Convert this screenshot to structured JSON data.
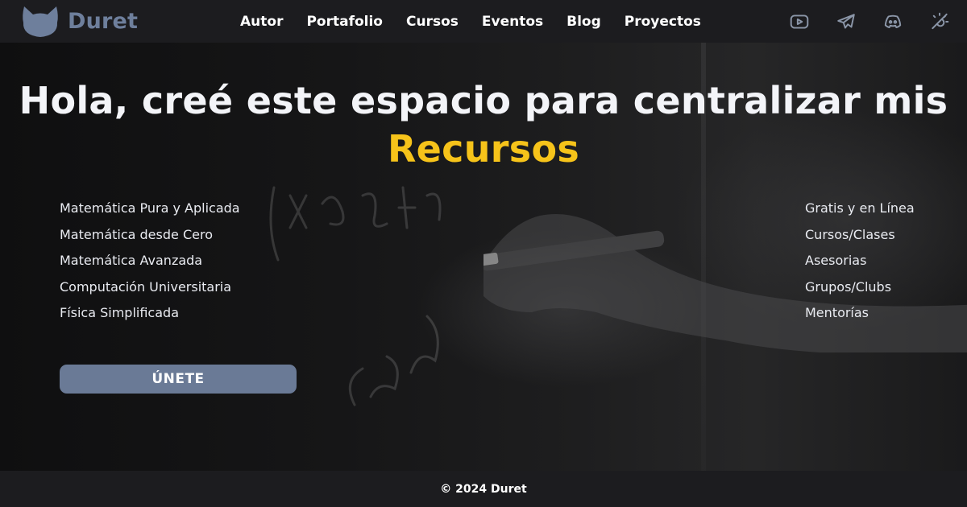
{
  "brand": {
    "name": "Duret",
    "logo_icon": "cat-head-icon",
    "color": "#6e7f9c"
  },
  "nav": {
    "links": [
      "Autor",
      "Portafolio",
      "Cursos",
      "Eventos",
      "Blog",
      "Proyectos"
    ],
    "icons": [
      "youtube-icon",
      "telegram-icon",
      "discord-icon",
      "theme-toggle-icon"
    ]
  },
  "hero": {
    "headline": "Hola, creé este espacio para centralizar mis",
    "accent": "Recursos",
    "accent_color": "#f6c31a",
    "topics": [
      "Matemática Pura y Aplicada",
      "Matemática desde Cero",
      "Matemática Avanzada",
      "Computación Universitaria",
      "Física Simplificada"
    ],
    "offerings": [
      "Gratis y en Línea",
      "Cursos/Clases",
      "Asesorias",
      "Grupos/Clubs",
      "Mentorías"
    ],
    "cta_label": "ÚNETE",
    "cta_color": "#6a7a96"
  },
  "footer": {
    "copyright": "© 2024 Duret"
  }
}
